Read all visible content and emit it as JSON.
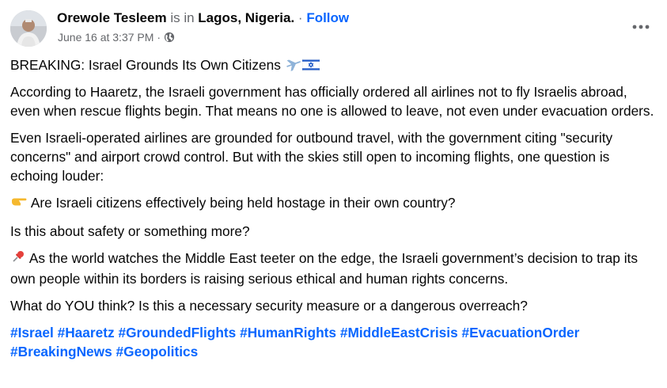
{
  "post": {
    "author": "Orewole Tesleem",
    "is_in_text": "is in",
    "location": "Lagos, Nigeria.",
    "separator": "·",
    "follow_label": "Follow",
    "timestamp": "June 16 at 3:37 PM",
    "meta_separator": "·",
    "audience_icon": "globe-icon",
    "more_icon": "more-options-icon",
    "headline": "BREAKING: Israel Grounds Its Own Citizens",
    "headline_emojis": [
      "airplane-emoji",
      "israel-flag-emoji"
    ],
    "paragraph_1": "According to Haaretz, the Israeli government has officially ordered all airlines not to fly Israelis abroad, even when rescue flights begin. That means no one is allowed to leave, not even under evacuation orders.",
    "paragraph_2": "Even Israeli-operated airlines are grounded for outbound travel, with the government citing \"security concerns\" and airport crowd control. But with the skies still open to incoming flights, one question is echoing louder:",
    "question_emoji": "pointing-hand-emoji",
    "question": "Are Israeli citizens effectively being held hostage in their own country?",
    "paragraph_3": "Is this about safety or something more?",
    "pin_emoji": "pushpin-emoji",
    "paragraph_4": "As the world watches the Middle East teeter on the edge, the Israeli government’s decision to trap its own people within its borders is raising serious ethical and human rights concerns.",
    "paragraph_5": "What do YOU think? Is this a necessary security measure or a dangerous overreach?",
    "hashtags": [
      "#Israel",
      "#Haaretz",
      "#GroundedFlights",
      "#HumanRights",
      "#MiddleEastCrisis",
      "#EvacuationOrder",
      "#BreakingNews",
      "#Geopolitics"
    ]
  },
  "colors": {
    "link_blue": "#0866ff",
    "secondary_text": "#65676b",
    "primary_text": "#050505"
  }
}
